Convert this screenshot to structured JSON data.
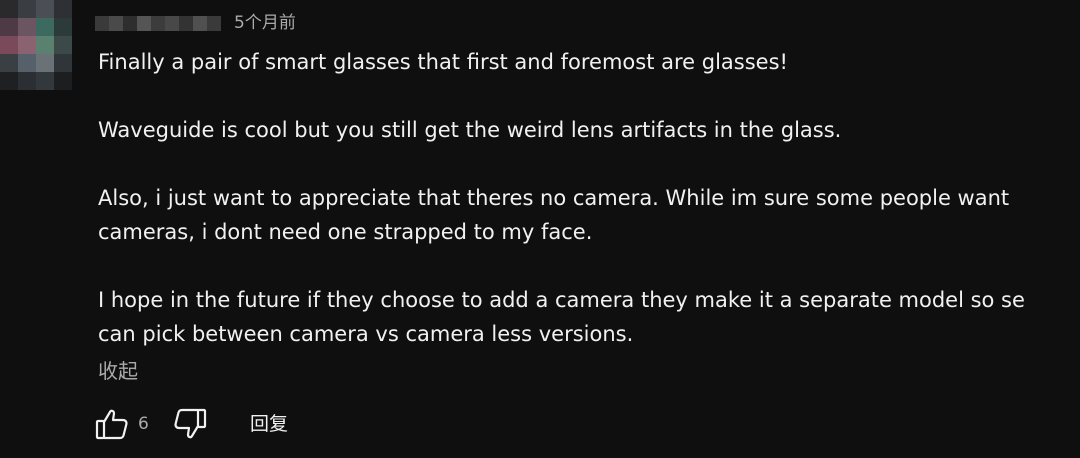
{
  "comment": {
    "timestamp": "5个月前",
    "paragraphs": [
      "Finally a pair of smart glasses that first and foremost are glasses!",
      "Waveguide is cool but you still get the weird lens artifacts in the glass.",
      "Also, i just want to appreciate that theres no camera. While im sure some people want cameras, i dont need one strapped to my face.",
      "I hope in the future if they choose to add a camera they make it a separate model so se can pick between camera vs camera less versions."
    ],
    "collapse_label": "收起",
    "like_count": "6",
    "reply_label": "回复",
    "icons": {
      "like": "thumbs-up-icon",
      "dislike": "thumbs-down-icon"
    }
  },
  "colors": {
    "background": "#0f0f0f",
    "text_primary": "#f1f1f1",
    "text_secondary": "#aaaaaa"
  }
}
